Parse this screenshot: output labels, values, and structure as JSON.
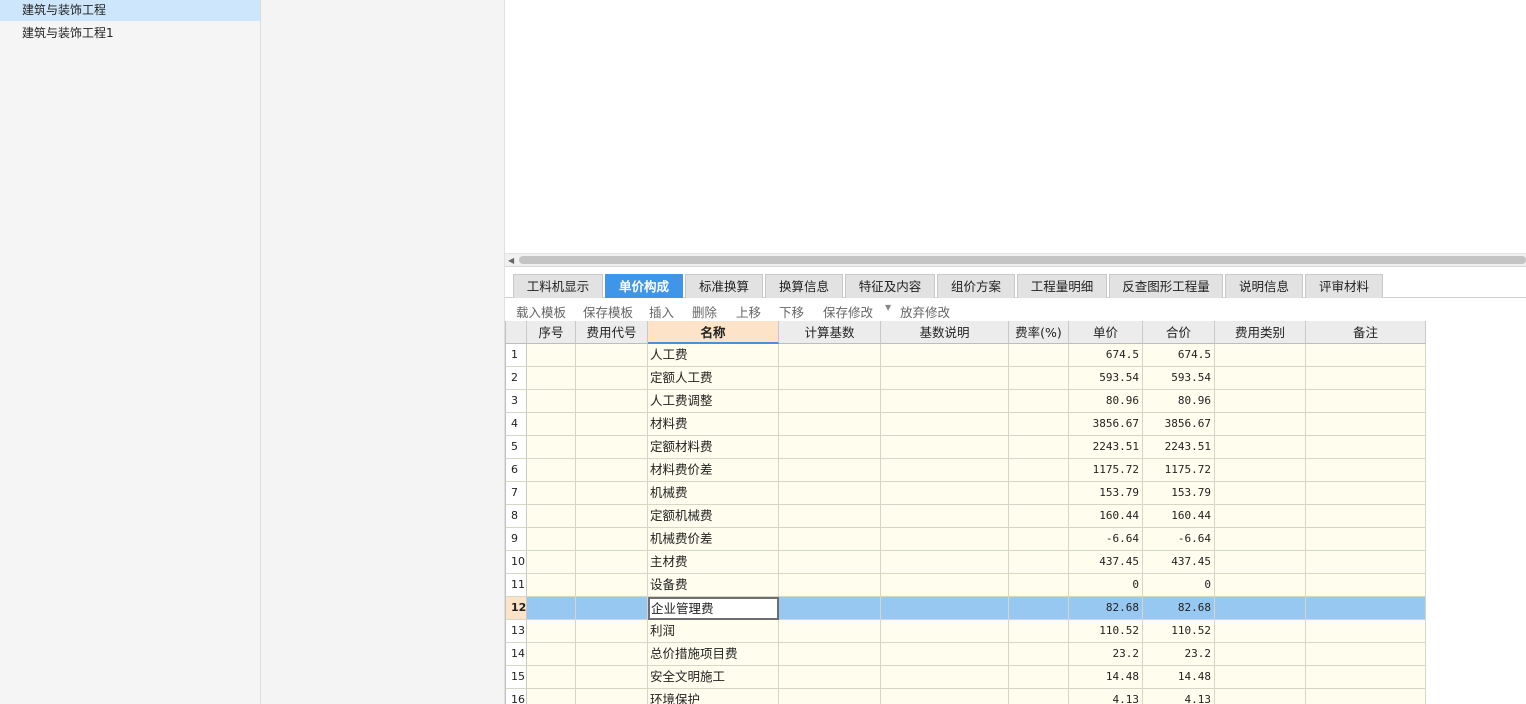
{
  "tree": {
    "items": [
      {
        "label": "建筑与装饰工程",
        "selected": true
      },
      {
        "label": "建筑与装饰工程1",
        "selected": false
      }
    ]
  },
  "tabs": [
    {
      "label": "工料机显示",
      "active": false
    },
    {
      "label": "单价构成",
      "active": true
    },
    {
      "label": "标准换算",
      "active": false
    },
    {
      "label": "换算信息",
      "active": false
    },
    {
      "label": "特征及内容",
      "active": false
    },
    {
      "label": "组价方案",
      "active": false
    },
    {
      "label": "工程量明细",
      "active": false
    },
    {
      "label": "反查图形工程量",
      "active": false
    },
    {
      "label": "说明信息",
      "active": false
    },
    {
      "label": "评审材料",
      "active": false
    }
  ],
  "toolbar": {
    "load_template": "载入模板",
    "save_template": "保存模板",
    "insert": "插入",
    "delete": "删除",
    "move_up": "上移",
    "move_down": "下移",
    "save_changes": "保存修改",
    "discard_changes": "放弃修改"
  },
  "grid": {
    "columns": [
      "序号",
      "费用代号",
      "名称",
      "计算基数",
      "基数说明",
      "费率(%)",
      "单价",
      "合价",
      "费用类别",
      "备注"
    ],
    "active_column": "名称",
    "selected_row": "12",
    "rows": [
      {
        "num": "1",
        "name": "人工费",
        "unit_price": "674.5",
        "total": "674.5"
      },
      {
        "num": "2",
        "name": "定额人工费",
        "unit_price": "593.54",
        "total": "593.54"
      },
      {
        "num": "3",
        "name": "人工费调整",
        "unit_price": "80.96",
        "total": "80.96"
      },
      {
        "num": "4",
        "name": "材料费",
        "unit_price": "3856.67",
        "total": "3856.67"
      },
      {
        "num": "5",
        "name": "定额材料费",
        "unit_price": "2243.51",
        "total": "2243.51"
      },
      {
        "num": "6",
        "name": "材料费价差",
        "unit_price": "1175.72",
        "total": "1175.72"
      },
      {
        "num": "7",
        "name": "机械费",
        "unit_price": "153.79",
        "total": "153.79"
      },
      {
        "num": "8",
        "name": "定额机械费",
        "unit_price": "160.44",
        "total": "160.44"
      },
      {
        "num": "9",
        "name": "机械费价差",
        "unit_price": "-6.64",
        "total": "-6.64"
      },
      {
        "num": "10",
        "name": "主材费",
        "unit_price": "437.45",
        "total": "437.45"
      },
      {
        "num": "11",
        "name": "设备费",
        "unit_price": "0",
        "total": "0"
      },
      {
        "num": "12",
        "name": "企业管理费",
        "unit_price": "82.68",
        "total": "82.68"
      },
      {
        "num": "13",
        "name": "利润",
        "unit_price": "110.52",
        "total": "110.52"
      },
      {
        "num": "14",
        "name": "总价措施项目费",
        "unit_price": "23.2",
        "total": "23.2"
      },
      {
        "num": "15",
        "name": "安全文明施工",
        "unit_price": "14.48",
        "total": "14.48"
      },
      {
        "num": "16",
        "name": "环境保护",
        "unit_price": "4.13",
        "total": "4.13"
      }
    ]
  },
  "colors": {
    "accent_tab": "#3f96e8",
    "selected_row": "#97c8f2",
    "cell_bg": "#fffdee",
    "active_header": "#fde3c8"
  }
}
